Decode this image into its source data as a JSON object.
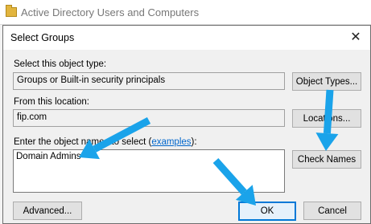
{
  "bg_window": {
    "title": "Active Directory Users and Computers"
  },
  "dialog": {
    "title": "Select Groups",
    "object_type_label": "Select this object type:",
    "object_type_value": "Groups or Built-in security principals",
    "object_types_button": "Object Types...",
    "location_label": "From this location:",
    "location_value": "fip.com",
    "locations_button": "Locations...",
    "names_label_before": "Enter the object names to select (",
    "examples_link": "examples",
    "names_label_after": "):",
    "names_value": "Domain Admins",
    "check_names_button": "Check Names",
    "advanced_button": "Advanced...",
    "ok_button": "OK",
    "cancel_button": "Cancel"
  },
  "colors": {
    "arrow": "#1aa3ea",
    "accent": "#0078d7"
  },
  "icons": {
    "close": "close-icon",
    "app": "folder-icon"
  }
}
